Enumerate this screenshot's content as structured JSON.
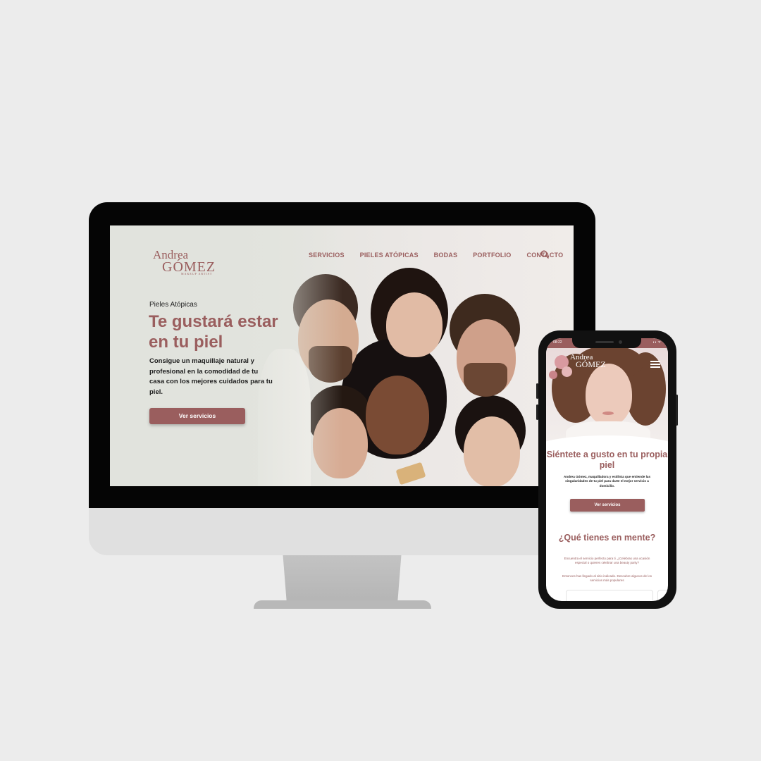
{
  "desktop": {
    "logo": {
      "line1": "Andrea",
      "line2": "GÓMEZ",
      "line3": "MAKEUP ARTIST"
    },
    "nav": [
      {
        "label": "SERVICIOS"
      },
      {
        "label": "PIELES ATÓPICAS"
      },
      {
        "label": "BODAS"
      },
      {
        "label": "PORTFOLIO"
      },
      {
        "label": "CONTACTO"
      }
    ],
    "search_icon": "search-icon",
    "hero": {
      "kicker": "Pieles Atópicas",
      "title": "Te gustará estar en tu piel",
      "text": "Consigue un maquillaje natural y profesional en la comodidad de tu casa con los mejores cuidados para tu piel.",
      "button": "Ver servicios"
    }
  },
  "mobile": {
    "status_time": "08:22",
    "status_right": "◖◗ ᯤ",
    "logo": {
      "line1": "Andrea",
      "line2": "GÓMEZ"
    },
    "menu_icon": "hamburger-icon",
    "section1": {
      "title": "Siéntete a gusto en tu propia piel",
      "text": "Andrea Gómez, maquilladora y estilista que entiende las singularidades de tu piel para darte el mejor servicio a domicilio.",
      "button": "Ver servicios"
    },
    "section2": {
      "title": "¿Qué tienes en mente?",
      "text1": "Encuentra el servicio perfecto para ti. ¿Celebras una ocasión especial o quieres celebrar una beauty party?",
      "text2": "Entonces has llegado al sitio indicado. Descubre algunos de los servicios más populares"
    }
  },
  "colors": {
    "accent": "#9a5e5e",
    "background": "#ececec"
  }
}
